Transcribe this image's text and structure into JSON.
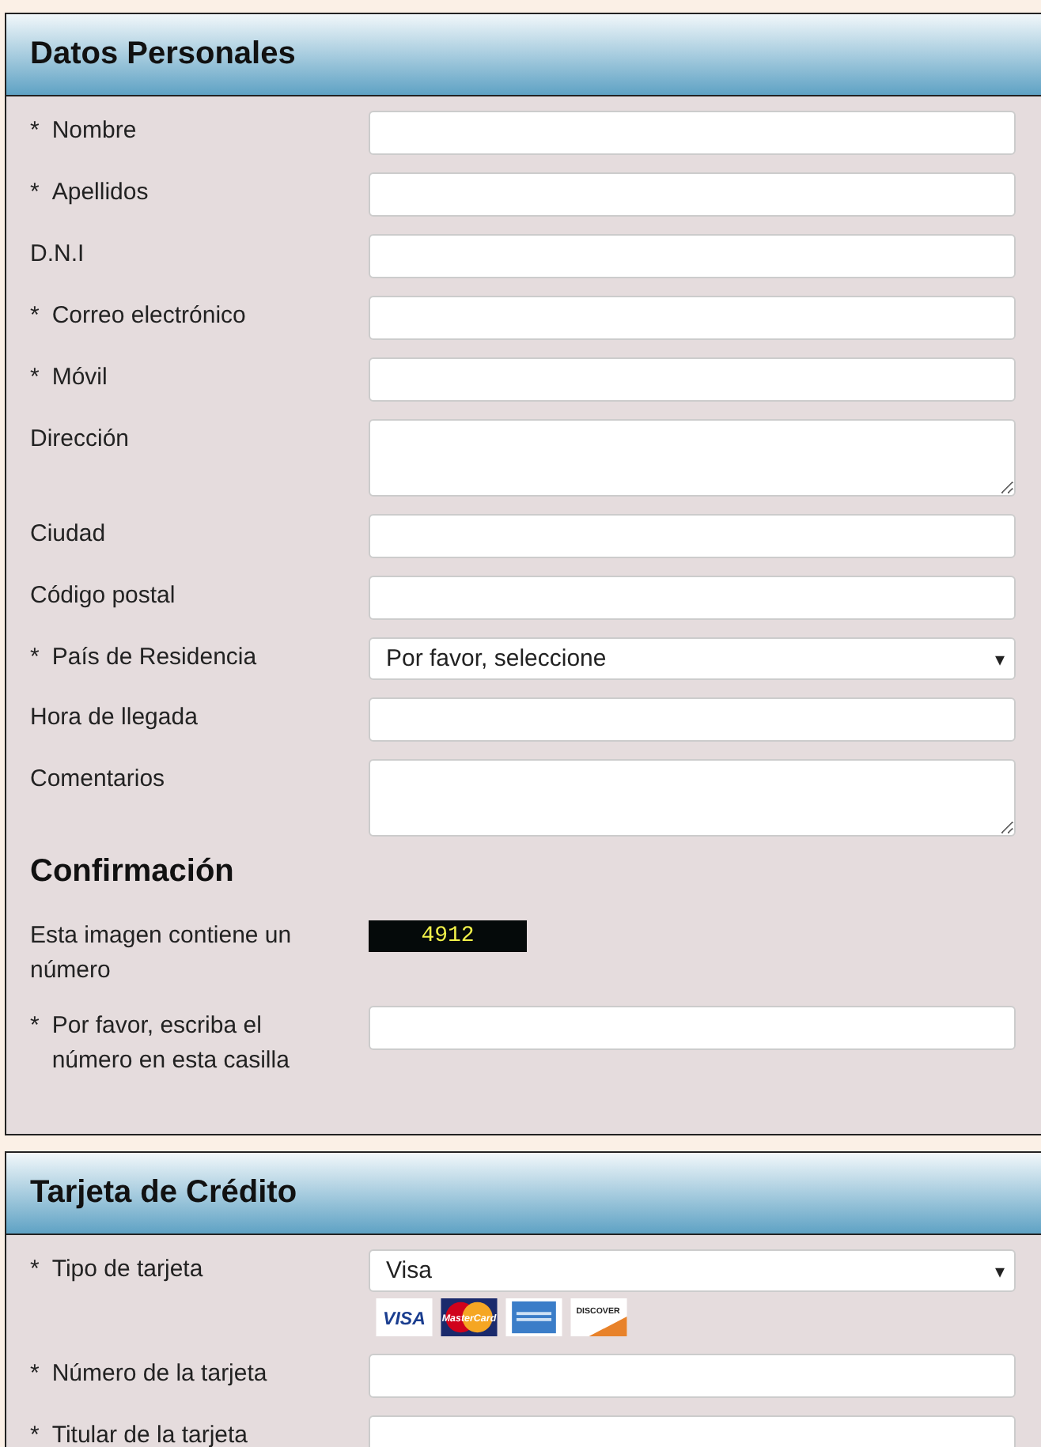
{
  "sections": [
    {
      "title": "Datos Personales",
      "fields": [
        {
          "kind": "text",
          "required_mark": "*",
          "label": "Nombre"
        },
        {
          "kind": "text",
          "required_mark": "*",
          "label": "Apellidos"
        },
        {
          "kind": "text",
          "label": "D.N.I"
        },
        {
          "kind": "text",
          "required_mark": "*",
          "label": "Correo electrónico"
        },
        {
          "kind": "text",
          "required_mark": "*",
          "label": "Móvil"
        },
        {
          "kind": "textarea",
          "label": "Dirección"
        },
        {
          "kind": "text",
          "label": "Ciudad"
        },
        {
          "kind": "text",
          "label": "Código postal"
        },
        {
          "kind": "select",
          "required_mark": "*",
          "label": "País de Residencia",
          "value": "Por favor, seleccione",
          "caret": "▾"
        },
        {
          "kind": "text",
          "label": "Hora de llegada"
        },
        {
          "kind": "textarea",
          "label": "Comentarios"
        }
      ],
      "subsection": {
        "title": "Confirmación",
        "fields": [
          {
            "kind": "captcha",
            "label": "Esta imagen contiene un número",
            "code": "4912"
          },
          {
            "kind": "text",
            "required_mark": "*",
            "label": "Por favor, escriba el número en esta casilla"
          }
        ]
      }
    },
    {
      "title": "Tarjeta de Crédito",
      "fields": [
        {
          "kind": "select",
          "required_mark": "*",
          "label": "Tipo de tarjeta",
          "value": "Visa",
          "caret": "▾",
          "cards": [
            {
              "kind": "visa",
              "label": "VISA"
            },
            {
              "kind": "mastercard",
              "label": "MasterCard"
            },
            {
              "kind": "amex"
            },
            {
              "kind": "discover",
              "label": "DISCOVER"
            }
          ]
        },
        {
          "kind": "text",
          "required_mark": "*",
          "label": "Número de la tarjeta"
        },
        {
          "kind": "text",
          "required_mark": "*",
          "label": "Titular de la tarjeta"
        }
      ]
    }
  ]
}
